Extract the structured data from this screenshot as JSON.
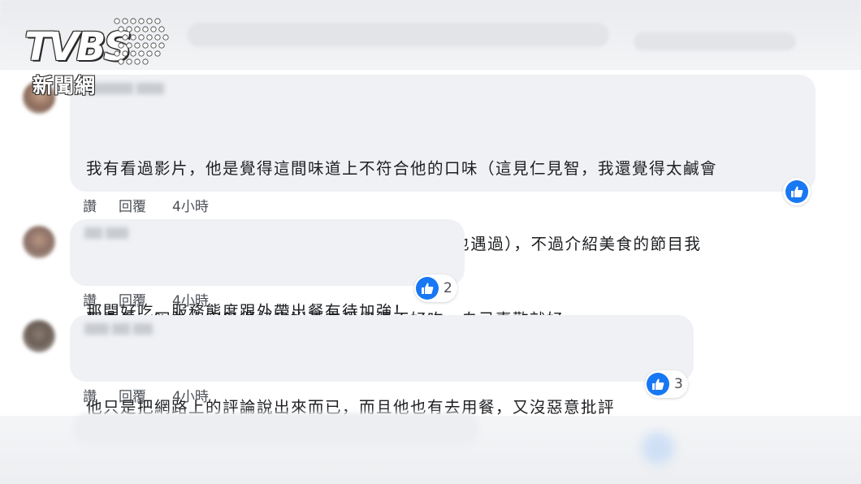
{
  "logo": {
    "brand": "TVBS",
    "subtitle": "新聞網"
  },
  "colors": {
    "like_blue": "#1877f2",
    "bubble_bg": "#eff1f4",
    "text": "#1c1e21"
  },
  "comments": [
    {
      "lines": [
        "我有看過影片，他是覺得這間味道上不符合他的口味（這見仁見智，我還覺得太鹹會",
        "叫老闆減量），還有他當天去買時說飯偏軟爛（我也遇過），不過介紹美食的節目我",
        "都看看，因為人家覺得好吃說不定我覺得不好吃，自己喜歡就好"
      ],
      "like_count": "",
      "actions": {
        "like": "讚",
        "reply": "回覆",
        "time": "4小時"
      }
    },
    {
      "lines": [
        "那間好吃。服務態度跟外帶出餐有待加強！"
      ],
      "like_count": "2",
      "actions": {
        "like": "讚",
        "reply": "回覆",
        "time": "4小時"
      }
    },
    {
      "lines": [
        "他只是把網路上的評論說出來而已，而且他也有去用餐，又沒惡意批評"
      ],
      "like_count": "3",
      "actions": {
        "like": "讚",
        "reply": "回覆",
        "time": "4小時"
      }
    }
  ]
}
